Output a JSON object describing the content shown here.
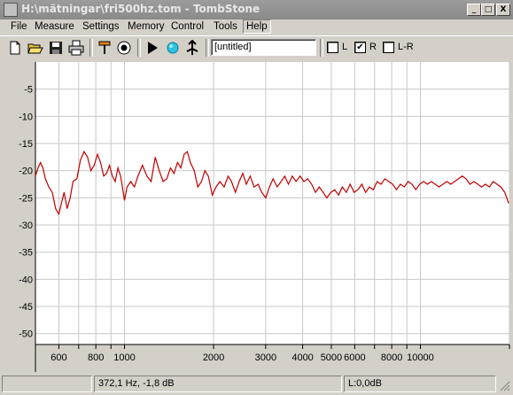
{
  "window": {
    "title": "H:\\mätningar\\fri500hz.tom - TombStone",
    "minimize_label": "_",
    "maximize_label": "□",
    "close_label": "X"
  },
  "menu": [
    "File",
    "Measure",
    "Settings",
    "Memory",
    "Control",
    "Tools",
    "Help"
  ],
  "toolbar": {
    "document_name": "[untitled]",
    "channels": [
      {
        "label": "L",
        "checked": false
      },
      {
        "label": "R",
        "checked": true
      },
      {
        "label": "L-R",
        "checked": false
      }
    ]
  },
  "status": {
    "cursor_readout": "372,1 Hz, -1,8 dB",
    "level_readout": "L:0,0dB"
  },
  "chart_data": {
    "type": "line",
    "title": "",
    "xlabel": "",
    "ylabel": "",
    "x_scale": "log",
    "xlim": [
      500,
      20000
    ],
    "ylim": [
      -52,
      0
    ],
    "y_ticks": [
      -5,
      -10,
      -15,
      -20,
      -25,
      -30,
      -35,
      -40,
      -45,
      -50
    ],
    "x_ticks": [
      600,
      800,
      1000,
      2000,
      3000,
      4000,
      5000,
      6000,
      8000,
      10000
    ],
    "x_gridlines": [
      600,
      700,
      800,
      900,
      1000,
      2000,
      3000,
      4000,
      5000,
      6000,
      7000,
      8000,
      9000,
      10000,
      20000
    ],
    "grid": true,
    "line_color": "#c00000",
    "series": [
      {
        "points": [
          [
            500,
            -21
          ],
          [
            510,
            -19.5
          ],
          [
            520,
            -18.5
          ],
          [
            530,
            -19.5
          ],
          [
            540,
            -21.5
          ],
          [
            555,
            -23
          ],
          [
            570,
            -24
          ],
          [
            585,
            -27
          ],
          [
            600,
            -28
          ],
          [
            612,
            -26
          ],
          [
            625,
            -24
          ],
          [
            640,
            -27
          ],
          [
            655,
            -25
          ],
          [
            670,
            -22
          ],
          [
            690,
            -21.5
          ],
          [
            710,
            -18
          ],
          [
            730,
            -16.5
          ],
          [
            750,
            -17.5
          ],
          [
            770,
            -20
          ],
          [
            790,
            -19
          ],
          [
            810,
            -17
          ],
          [
            830,
            -18.5
          ],
          [
            850,
            -21
          ],
          [
            870,
            -20.5
          ],
          [
            890,
            -19
          ],
          [
            910,
            -21
          ],
          [
            930,
            -22
          ],
          [
            950,
            -19.5
          ],
          [
            970,
            -21
          ],
          [
            990,
            -24
          ],
          [
            1000,
            -25.5
          ],
          [
            1020,
            -23
          ],
          [
            1050,
            -22
          ],
          [
            1080,
            -23
          ],
          [
            1110,
            -21
          ],
          [
            1150,
            -19
          ],
          [
            1190,
            -21
          ],
          [
            1230,
            -22
          ],
          [
            1270,
            -17.5
          ],
          [
            1310,
            -20
          ],
          [
            1350,
            -22
          ],
          [
            1390,
            -21.5
          ],
          [
            1430,
            -19.5
          ],
          [
            1470,
            -20.5
          ],
          [
            1510,
            -18.5
          ],
          [
            1550,
            -19.5
          ],
          [
            1590,
            -17
          ],
          [
            1630,
            -16.5
          ],
          [
            1670,
            -18.5
          ],
          [
            1720,
            -20
          ],
          [
            1770,
            -23
          ],
          [
            1820,
            -22
          ],
          [
            1870,
            -20
          ],
          [
            1920,
            -21
          ],
          [
            1980,
            -24.5
          ],
          [
            2040,
            -23
          ],
          [
            2100,
            -22
          ],
          [
            2170,
            -23
          ],
          [
            2240,
            -21
          ],
          [
            2300,
            -22
          ],
          [
            2370,
            -24
          ],
          [
            2440,
            -22
          ],
          [
            2510,
            -20.5
          ],
          [
            2580,
            -22.5
          ],
          [
            2660,
            -21
          ],
          [
            2740,
            -23
          ],
          [
            2830,
            -22.5
          ],
          [
            2910,
            -24
          ],
          [
            3000,
            -25
          ],
          [
            3090,
            -23
          ],
          [
            3180,
            -21.5
          ],
          [
            3280,
            -23
          ],
          [
            3380,
            -22
          ],
          [
            3480,
            -21
          ],
          [
            3580,
            -22.5
          ],
          [
            3690,
            -21
          ],
          [
            3800,
            -22
          ],
          [
            3920,
            -21
          ],
          [
            4040,
            -22
          ],
          [
            4160,
            -21.5
          ],
          [
            4290,
            -22.5
          ],
          [
            4420,
            -24
          ],
          [
            4550,
            -23
          ],
          [
            4690,
            -24
          ],
          [
            4830,
            -25
          ],
          [
            4980,
            -24
          ],
          [
            5130,
            -23.5
          ],
          [
            5290,
            -24.5
          ],
          [
            5450,
            -23
          ],
          [
            5620,
            -24
          ],
          [
            5790,
            -22.5
          ],
          [
            5970,
            -24
          ],
          [
            6150,
            -23.5
          ],
          [
            6340,
            -22.5
          ],
          [
            6530,
            -24
          ],
          [
            6730,
            -23
          ],
          [
            6930,
            -23.5
          ],
          [
            7140,
            -22
          ],
          [
            7360,
            -22.5
          ],
          [
            7590,
            -21.5
          ],
          [
            7820,
            -22
          ],
          [
            8060,
            -22.5
          ],
          [
            8300,
            -23.5
          ],
          [
            8560,
            -22.5
          ],
          [
            8820,
            -23
          ],
          [
            9090,
            -22
          ],
          [
            9370,
            -22.5
          ],
          [
            9650,
            -23.5
          ],
          [
            9950,
            -22.5
          ],
          [
            10250,
            -22
          ],
          [
            10560,
            -22.5
          ],
          [
            10890,
            -22
          ],
          [
            11220,
            -22.5
          ],
          [
            11560,
            -23
          ],
          [
            11920,
            -22.5
          ],
          [
            12280,
            -22
          ],
          [
            12660,
            -22.5
          ],
          [
            13040,
            -22
          ],
          [
            13440,
            -21.5
          ],
          [
            13850,
            -21
          ],
          [
            14270,
            -21.5
          ],
          [
            14710,
            -22.5
          ],
          [
            15160,
            -22
          ],
          [
            15620,
            -22.5
          ],
          [
            16100,
            -23
          ],
          [
            16590,
            -22.5
          ],
          [
            17100,
            -23
          ],
          [
            17620,
            -22
          ],
          [
            18160,
            -22.5
          ],
          [
            18710,
            -23
          ],
          [
            19280,
            -24
          ],
          [
            19870,
            -26
          ]
        ]
      }
    ]
  }
}
